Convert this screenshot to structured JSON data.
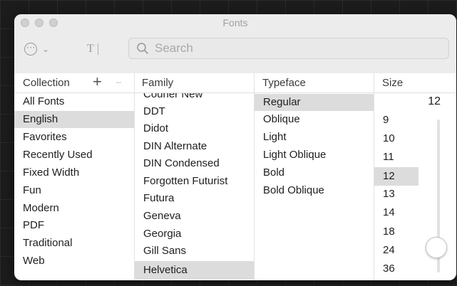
{
  "window": {
    "title": "Fonts"
  },
  "toolbar": {
    "action_glyph": "⋯",
    "action_chevron": "⌄",
    "text_glyph": "T",
    "search_placeholder": "Search"
  },
  "headers": {
    "collection": "Collection",
    "add": "+",
    "remove": "−",
    "family": "Family",
    "typeface": "Typeface",
    "size": "Size"
  },
  "collections": [
    "All Fonts",
    "English",
    "Favorites",
    "Recently Used",
    "Fixed Width",
    "Fun",
    "Modern",
    "PDF",
    "Traditional",
    "Web"
  ],
  "selected_collection": "English",
  "families": [
    "Courier New",
    "DDT",
    "Didot",
    "DIN Alternate",
    "DIN Condensed",
    "Forgotten Futurist",
    "Futura",
    "Geneva",
    "Georgia",
    "Gill Sans",
    "Helvetica"
  ],
  "selected_family": "Helvetica",
  "typefaces": [
    "Regular",
    "Oblique",
    "Light",
    "Light Oblique",
    "Bold",
    "Bold Oblique"
  ],
  "selected_typeface": "Regular",
  "size": {
    "value": "12",
    "options": [
      "9",
      "10",
      "11",
      "12",
      "13",
      "14",
      "18",
      "24",
      "36"
    ],
    "selected": "12"
  },
  "colors": {
    "selection": "#dcdcdc",
    "titlebar": "#ececec"
  }
}
